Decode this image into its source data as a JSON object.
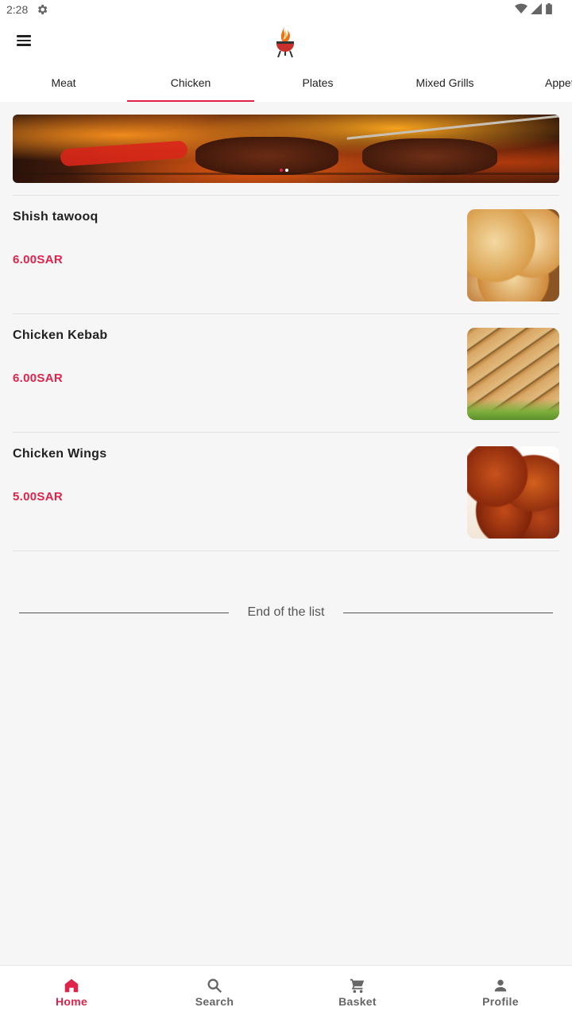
{
  "status_bar": {
    "time": "2:28"
  },
  "tabs": [
    {
      "label": "Meat"
    },
    {
      "label": "Chicken"
    },
    {
      "label": "Plates"
    },
    {
      "label": "Mixed Grills"
    },
    {
      "label": "Appet"
    }
  ],
  "active_tab": "Chicken",
  "banner": {
    "slides": 2,
    "active_slide": 1
  },
  "items": [
    {
      "name": "Shish tawooq",
      "price": "6.00SAR"
    },
    {
      "name": "Chicken Kebab",
      "price": "6.00SAR"
    },
    {
      "name": "Chicken Wings",
      "price": "5.00SAR"
    }
  ],
  "end_of_list": "End of the list",
  "bottom_nav": [
    {
      "label": "Home",
      "icon": "home-icon"
    },
    {
      "label": "Search",
      "icon": "search-icon"
    },
    {
      "label": "Basket",
      "icon": "cart-icon"
    },
    {
      "label": "Profile",
      "icon": "person-icon"
    }
  ],
  "colors": {
    "accent": "#e0234b",
    "background": "#f6f6f6"
  }
}
